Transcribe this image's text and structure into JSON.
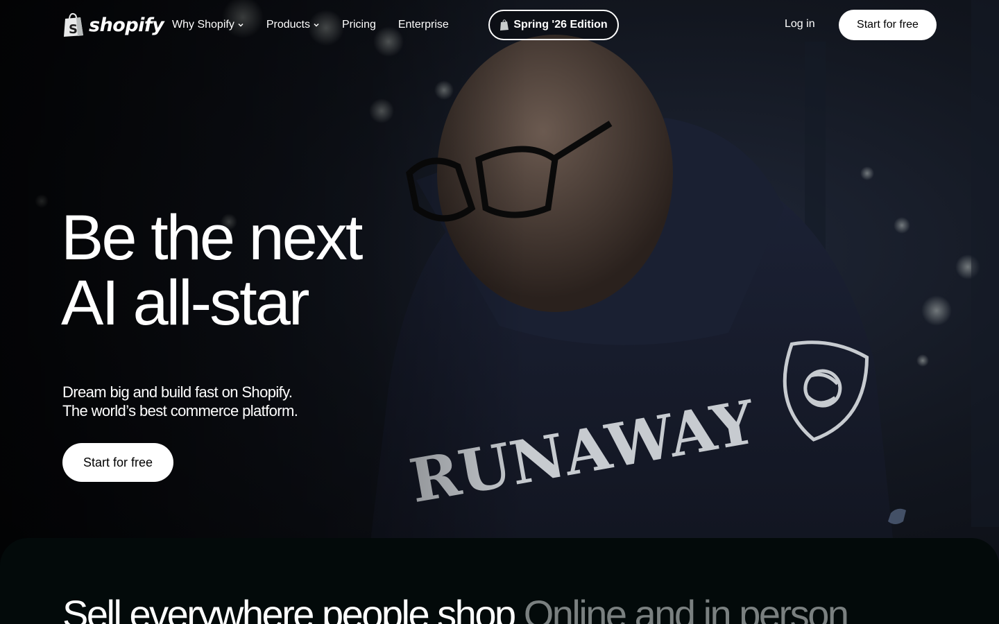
{
  "brand": {
    "name": "shopify"
  },
  "nav": {
    "items": [
      {
        "label": "Why Shopify",
        "has_dropdown": true
      },
      {
        "label": "Products",
        "has_dropdown": true
      },
      {
        "label": "Pricing",
        "has_dropdown": false
      },
      {
        "label": "Enterprise",
        "has_dropdown": false
      }
    ],
    "edition_label": "Spring '26 Edition",
    "login_label": "Log in",
    "cta_label": "Start for free"
  },
  "hero": {
    "headline_line1": "Be the next",
    "headline_line2": "AI all-star",
    "sub_line1": "Dream big and build fast on Shopify.",
    "sub_line2": "The world’s best commerce platform.",
    "cta_label": "Start for free",
    "hoodie_text": "RUNAWAY"
  },
  "section2": {
    "title_strong": "Sell everywhere people shop",
    "title_muted": "Online and in person"
  },
  "colors": {
    "primary_text": "#ffffff",
    "button_bg": "#ffffff",
    "button_text": "#000000",
    "section_bg": "#030a0a",
    "muted_text": "#7a8080"
  }
}
